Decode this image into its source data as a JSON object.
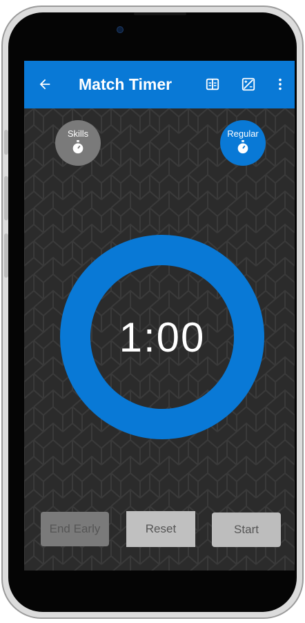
{
  "appbar": {
    "title": "Match Timer",
    "back_icon": "arrow-left-icon",
    "actions": [
      {
        "icon": "book-icon"
      },
      {
        "icon": "image-edit-icon"
      },
      {
        "icon": "more-vert-icon"
      }
    ]
  },
  "modes": {
    "skills": {
      "label": "Skills",
      "icon": "stopwatch-icon",
      "selected": false
    },
    "regular": {
      "label": "Regular",
      "icon": "stopwatch-icon",
      "selected": true
    }
  },
  "timer": {
    "display": "1:00"
  },
  "controls": {
    "end_early": "End Early",
    "reset": "Reset",
    "start": "Start"
  },
  "colors": {
    "primary": "#0979d6",
    "background": "#2b2b2b",
    "disabled": "#7a7a7a"
  }
}
